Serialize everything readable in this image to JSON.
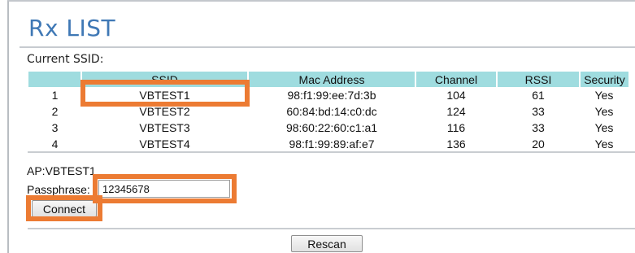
{
  "header": {
    "title": "Rx LIST"
  },
  "current_ssid_label": "Current SSID:",
  "table": {
    "headers": [
      "",
      "SSID",
      "Mac Address",
      "Channel",
      "RSSI",
      "Security"
    ],
    "rows": [
      [
        "1",
        "VBTEST1",
        "98:f1:99:ee:7d:3b",
        "104",
        "61",
        "Yes"
      ],
      [
        "2",
        "VBTEST2",
        "60:84:bd:14:c0:dc",
        "124",
        "33",
        "Yes"
      ],
      [
        "3",
        "VBTEST3",
        "98:60:22:60:c1:a1",
        "116",
        "33",
        "Yes"
      ],
      [
        "4",
        "VBTEST4",
        "98:f1:99:89:af:e7",
        "136",
        "20",
        "Yes"
      ]
    ]
  },
  "connect_form": {
    "ap_label": "AP:VBTEST1",
    "passphrase_label": "Passphrase:",
    "passphrase_value": "12345678",
    "connect_label": "Connect"
  },
  "rescan_label": "Rescan",
  "colors": {
    "title": "#3f78b5",
    "table_header_bg": "#9fdcdf",
    "highlight": "#ec7b33"
  }
}
